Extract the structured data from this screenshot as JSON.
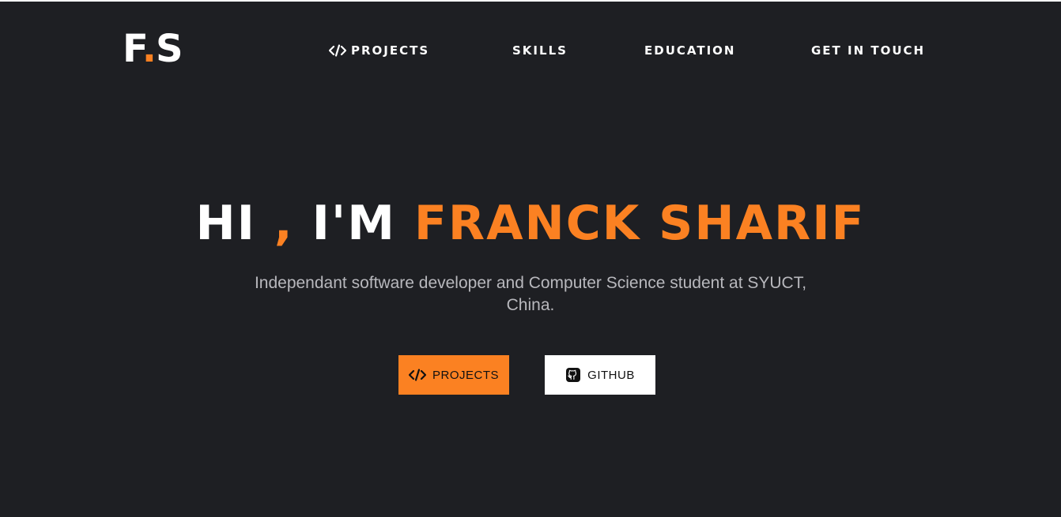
{
  "header": {
    "logo": {
      "first": "F",
      "dot": ".",
      "last": "S"
    },
    "nav": [
      {
        "label": "PROJECTS",
        "icon": "code-icon"
      },
      {
        "label": "SKILLS"
      },
      {
        "label": "EDUCATION"
      },
      {
        "label": "GET IN TOUCH"
      }
    ]
  },
  "hero": {
    "greeting": "HI",
    "comma": " , ",
    "intro": "I'M ",
    "name": "FRANCK SHARIF",
    "subtitle": "Independant software developer and Computer Science student at SYUCT, China."
  },
  "buttons": {
    "projects": {
      "label": "PROJECTS",
      "icon": "code-icon"
    },
    "github": {
      "label": "GITHUB",
      "icon": "github-icon"
    }
  },
  "colors": {
    "background": "#1e1f23",
    "accent": "#fb8122",
    "text": "#ffffff",
    "subtitle": "#b8b8bd"
  }
}
